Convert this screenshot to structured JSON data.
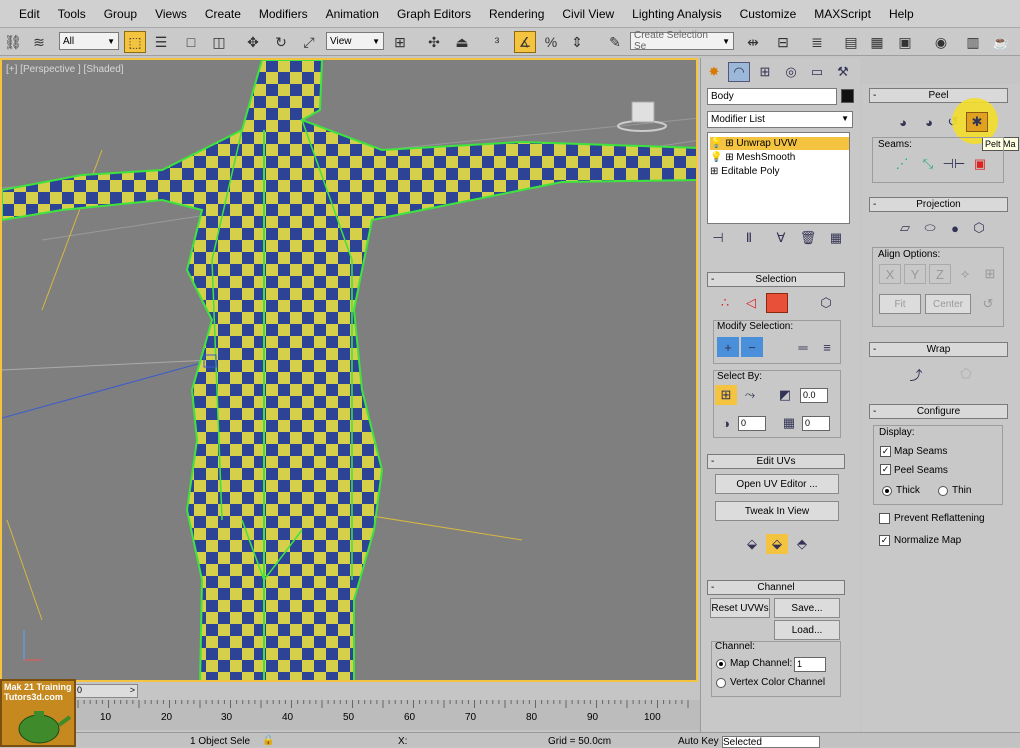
{
  "menu": [
    "Edit",
    "Tools",
    "Group",
    "Views",
    "Create",
    "Modifiers",
    "Animation",
    "Graph Editors",
    "Rendering",
    "Civil View",
    "Lighting Analysis",
    "Customize",
    "MAXScript",
    "Help"
  ],
  "toolbar": {
    "filter_value": "All",
    "ref_coord_value": "View",
    "selection_set_placeholder": "Create Selection Se"
  },
  "viewport": {
    "label": "[+] [Perspective ] [Shaded]"
  },
  "command_panel": {
    "object_name": "Body",
    "modifier_list_label": "Modifier List",
    "stack": [
      "Unwrap UVW",
      "MeshSmooth",
      "Editable Poly"
    ],
    "selection": {
      "title": "Selection",
      "modify_selection_label": "Modify Selection:",
      "select_by_label": "Select By:",
      "angle_value": "0.0",
      "spin1_value": "0",
      "spin2_value": "0"
    },
    "edit_uvs": {
      "title": "Edit UVs",
      "open_uv_editor": "Open UV Editor ...",
      "tweak_in_view": "Tweak In View"
    },
    "channel": {
      "title": "Channel",
      "reset_uvws": "Reset UVWs",
      "save": "Save...",
      "load": "Load...",
      "channel_label": "Channel:",
      "map_channel_label": "Map Channel:",
      "map_channel_value": "1",
      "vertex_color_channel": "Vertex Color Channel"
    }
  },
  "right_panel": {
    "peel": {
      "title": "Peel",
      "seams_label": "Seams:",
      "tooltip": "Pelt Ma"
    },
    "projection": {
      "title": "Projection",
      "align_options_label": "Align Options:",
      "fit": "Fit",
      "center": "Center"
    },
    "wrap": {
      "title": "Wrap"
    },
    "configure": {
      "title": "Configure",
      "display_label": "Display:",
      "map_seams": "Map Seams",
      "peel_seams": "Peel Seams",
      "thick": "Thick",
      "thin": "Thin",
      "prevent_reflattening": "Prevent Reflattening",
      "normalize_map": "Normalize Map"
    }
  },
  "timeline": {
    "frame_display": "0",
    "ticks": [
      "10",
      "20",
      "30",
      "40",
      "50",
      "60",
      "70",
      "80",
      "90",
      "100"
    ]
  },
  "statusbar": {
    "object_sel": "1 Object Sele",
    "x_label": "X:",
    "grid": "Grid = 50.0cm",
    "autokey": "Auto Key",
    "selected": "Selected"
  },
  "logo": {
    "line1": "Mak 21 Training",
    "line2": "Tutors3d.com"
  },
  "colors": {
    "accent": "#f4c441",
    "viewport_bg": "#7f7f7f",
    "panel_bg": "#c8c8c8"
  }
}
